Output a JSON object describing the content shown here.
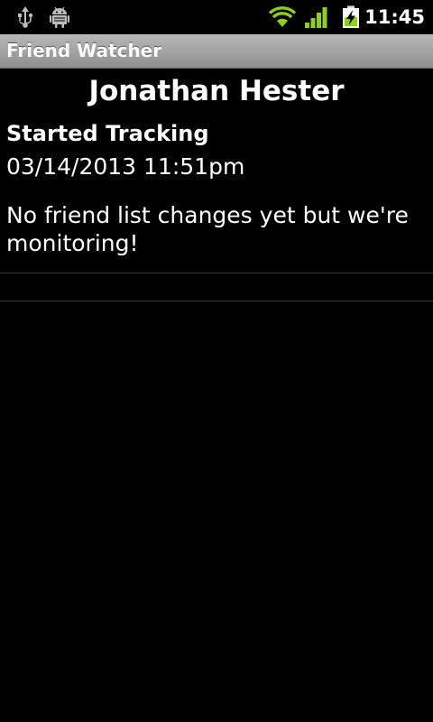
{
  "status_bar": {
    "clock": "11:45",
    "icons": [
      "usb-icon",
      "debug-icon",
      "wifi-icon",
      "signal-icon",
      "battery-charging-icon"
    ],
    "accent_green": "#8ccf1f"
  },
  "app": {
    "title": "Friend Watcher"
  },
  "friend": {
    "name": "Jonathan Hester",
    "section_heading": "Started Tracking",
    "tracking_date": "03/14/2013 11:51pm",
    "status_message": "No friend list changes yet but we're monitoring!"
  }
}
